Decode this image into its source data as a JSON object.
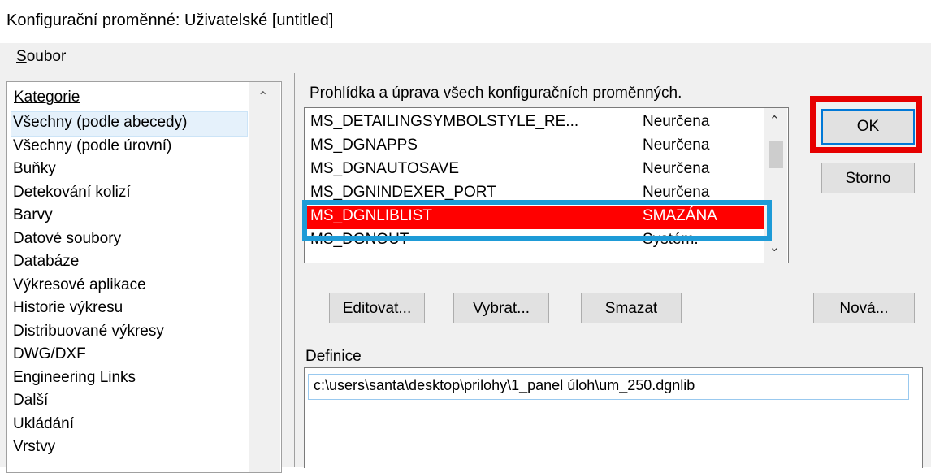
{
  "window": {
    "title": "Konfigurační proměnné: Uživatelské [untitled]"
  },
  "menu": {
    "file_label": "Soubor"
  },
  "categories": {
    "header": "Kategorie",
    "items": [
      "Všechny (podle abecedy)",
      "Všechny (podle úrovní)",
      "Buňky",
      "Detekování kolizí",
      "Barvy",
      "Datové soubory",
      "Databáze",
      "Výkresové aplikace",
      "Historie výkresu",
      "Distribuované výkresy",
      "DWG/DXF",
      "Engineering Links",
      "Další",
      "Ukládání",
      "Vrstvy"
    ],
    "selected_index": 0
  },
  "variables": {
    "description": "Prohlídka a úprava všech konfiguračních proměnných.",
    "rows": [
      {
        "name": "MS_DETAILINGSYMBOLSTYLE_RE...",
        "value": "Neurčena"
      },
      {
        "name": "MS_DGNAPPS",
        "value": "Neurčena"
      },
      {
        "name": "MS_DGNAUTOSAVE",
        "value": "Neurčena"
      },
      {
        "name": "MS_DGNINDEXER_PORT",
        "value": "Neurčena"
      },
      {
        "name": "MS_DGNLIBLIST",
        "value": "SMAZÁNA"
      },
      {
        "name": "MS_DGNOUT",
        "value": "Systém."
      }
    ],
    "selected_index": 4
  },
  "buttons": {
    "ok": "OK",
    "cancel": "Storno",
    "edit": "Editovat...",
    "select": "Vybrat...",
    "delete": "Smazat",
    "new": "Nová..."
  },
  "definition": {
    "label": "Definice",
    "value": "c:\\users\\santa\\desktop\\prilohy\\1_panel úloh\\um_250.dgnlib"
  },
  "colors": {
    "selection_row": "#ff0000",
    "highlight_blue": "#1e9bd7",
    "highlight_red": "#e60000"
  },
  "icons": {
    "scroll_up": "chevron-up-icon",
    "scroll_down": "chevron-down-icon"
  }
}
